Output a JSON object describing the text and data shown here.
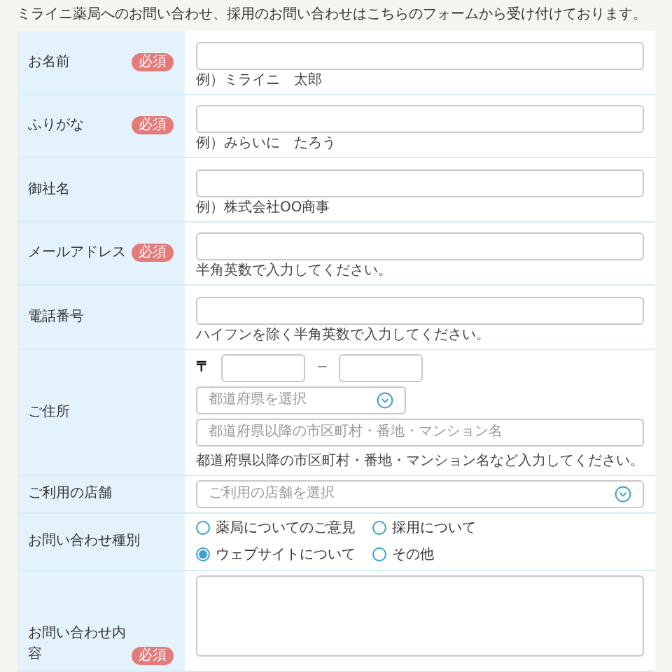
{
  "intro": "ミライニ薬局へのお問い合わせ、採用のお問い合わせはこちらのフォームから受け付けております。",
  "fields": [
    {
      "kind": "text",
      "label": "お名前",
      "badge": "必須",
      "hint": "例）ミライニ　太郎"
    },
    {
      "kind": "text",
      "label": "ふりがな",
      "badge": "必須",
      "hint": "例）みらいに　たろう"
    },
    {
      "kind": "text",
      "label": "御社名",
      "hint": "例）株式会社OO商事"
    },
    {
      "kind": "text",
      "label": "メールアドレス",
      "badge": "必須",
      "hint": "半角英数で入力してください。"
    },
    {
      "kind": "text",
      "label": "電話番号",
      "hint": "ハイフンを除く半角英数で入力してください。"
    },
    {
      "kind": "address",
      "label": "ご住所",
      "zip_mark": "〒",
      "zip_dash": "−",
      "prefecture_placeholder": "都道府県を選択",
      "street_placeholder": "都道府県以降の市区町村・番地・マンション名",
      "hint": "都道府県以降の市区町村・番地・マンション名など入力してください。"
    },
    {
      "kind": "select",
      "label": "ご利用の店舗",
      "placeholder": "ご利用の店舗を選択"
    },
    {
      "kind": "radio",
      "label": "お問い合わせ種別",
      "options": [
        {
          "label": "薬局についてのご意見",
          "selected": false
        },
        {
          "label": "採用について",
          "selected": false
        },
        {
          "label": "ウェブサイトについて",
          "selected": true
        },
        {
          "label": "その他",
          "selected": false
        }
      ]
    },
    {
      "kind": "textarea",
      "label": "お問い合わせ内容",
      "badge": "必須"
    }
  ]
}
